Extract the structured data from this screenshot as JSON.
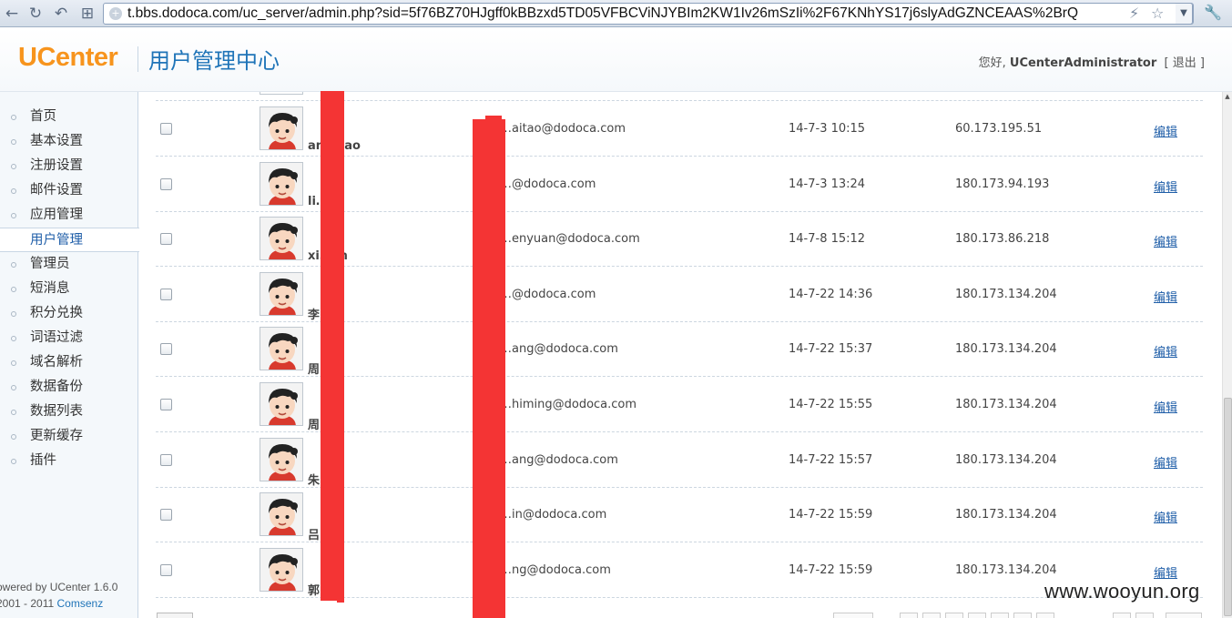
{
  "browser": {
    "url": "t.bbs.dodoca.com/uc_server/admin.php?sid=5f76BZ70HJgff0kBBzxd5TD05VFBCViNJYBIm2KW1Iv26mSzIi%2F67KNhYS17j6slyAdGZNCEAAS%2BrQ",
    "back_icon": "back-arrow-icon",
    "reload_icon": "reload-icon",
    "undo_icon": "undo-icon",
    "tiles_icon": "tiles-icon"
  },
  "header": {
    "logo": "UCenter",
    "title": "用户管理中心",
    "greeting": "您好,",
    "username": "UCenterAdministrator",
    "logout_open": "[",
    "logout": "退出",
    "logout_close": "]"
  },
  "sidebar": {
    "items": [
      {
        "label": "首页"
      },
      {
        "label": "基本设置"
      },
      {
        "label": "注册设置"
      },
      {
        "label": "邮件设置"
      },
      {
        "label": "应用管理"
      },
      {
        "label": "用户管理",
        "active": true
      },
      {
        "label": "管理员"
      },
      {
        "label": "短消息"
      },
      {
        "label": "积分兑换"
      },
      {
        "label": "词语过滤"
      },
      {
        "label": "域名解析"
      },
      {
        "label": "数据备份"
      },
      {
        "label": "数据列表"
      },
      {
        "label": "更新缓存"
      },
      {
        "label": "插件"
      }
    ],
    "powered": "owered by UCenter 1.6.0",
    "copyright": "2001 - 2011",
    "copyright_brand": "Comsenz"
  },
  "users": [
    {
      "name": "an…hao",
      "email": "…aitao@dodoca.com",
      "date": "14-7-3 10:15",
      "ip": "60.173.195.51",
      "edit": "编辑"
    },
    {
      "name": "li…",
      "email": "…@dodoca.com",
      "date": "14-7-3 13:24",
      "ip": "180.173.94.193",
      "edit": "编辑"
    },
    {
      "name": "xi…en",
      "email": "…enyuan@dodoca.com",
      "date": "14-7-8 15:12",
      "ip": "180.173.86.218",
      "edit": "编辑"
    },
    {
      "name": "李",
      "email": "…@dodoca.com",
      "date": "14-7-22 14:36",
      "ip": "180.173.134.204",
      "edit": "编辑"
    },
    {
      "name": "周",
      "email": "…ang@dodoca.com",
      "date": "14-7-22 15:37",
      "ip": "180.173.134.204",
      "edit": "编辑"
    },
    {
      "name": "周",
      "email": "…himing@dodoca.com",
      "date": "14-7-22 15:55",
      "ip": "180.173.134.204",
      "edit": "编辑"
    },
    {
      "name": "朱",
      "email": "…ang@dodoca.com",
      "date": "14-7-22 15:57",
      "ip": "180.173.134.204",
      "edit": "编辑"
    },
    {
      "name": "吕",
      "email": "…in@dodoca.com",
      "date": "14-7-22 15:59",
      "ip": "180.173.134.204",
      "edit": "编辑"
    },
    {
      "name": "郭",
      "email": "…ng@dodoca.com",
      "date": "14-7-22 15:59",
      "ip": "180.173.134.204",
      "edit": "编辑"
    }
  ],
  "colors": {
    "redaction": "#f43434",
    "logo": "#f7941d",
    "title": "#1f74b8",
    "link": "#1f5ea8"
  },
  "watermark": "www.wooyun.org"
}
